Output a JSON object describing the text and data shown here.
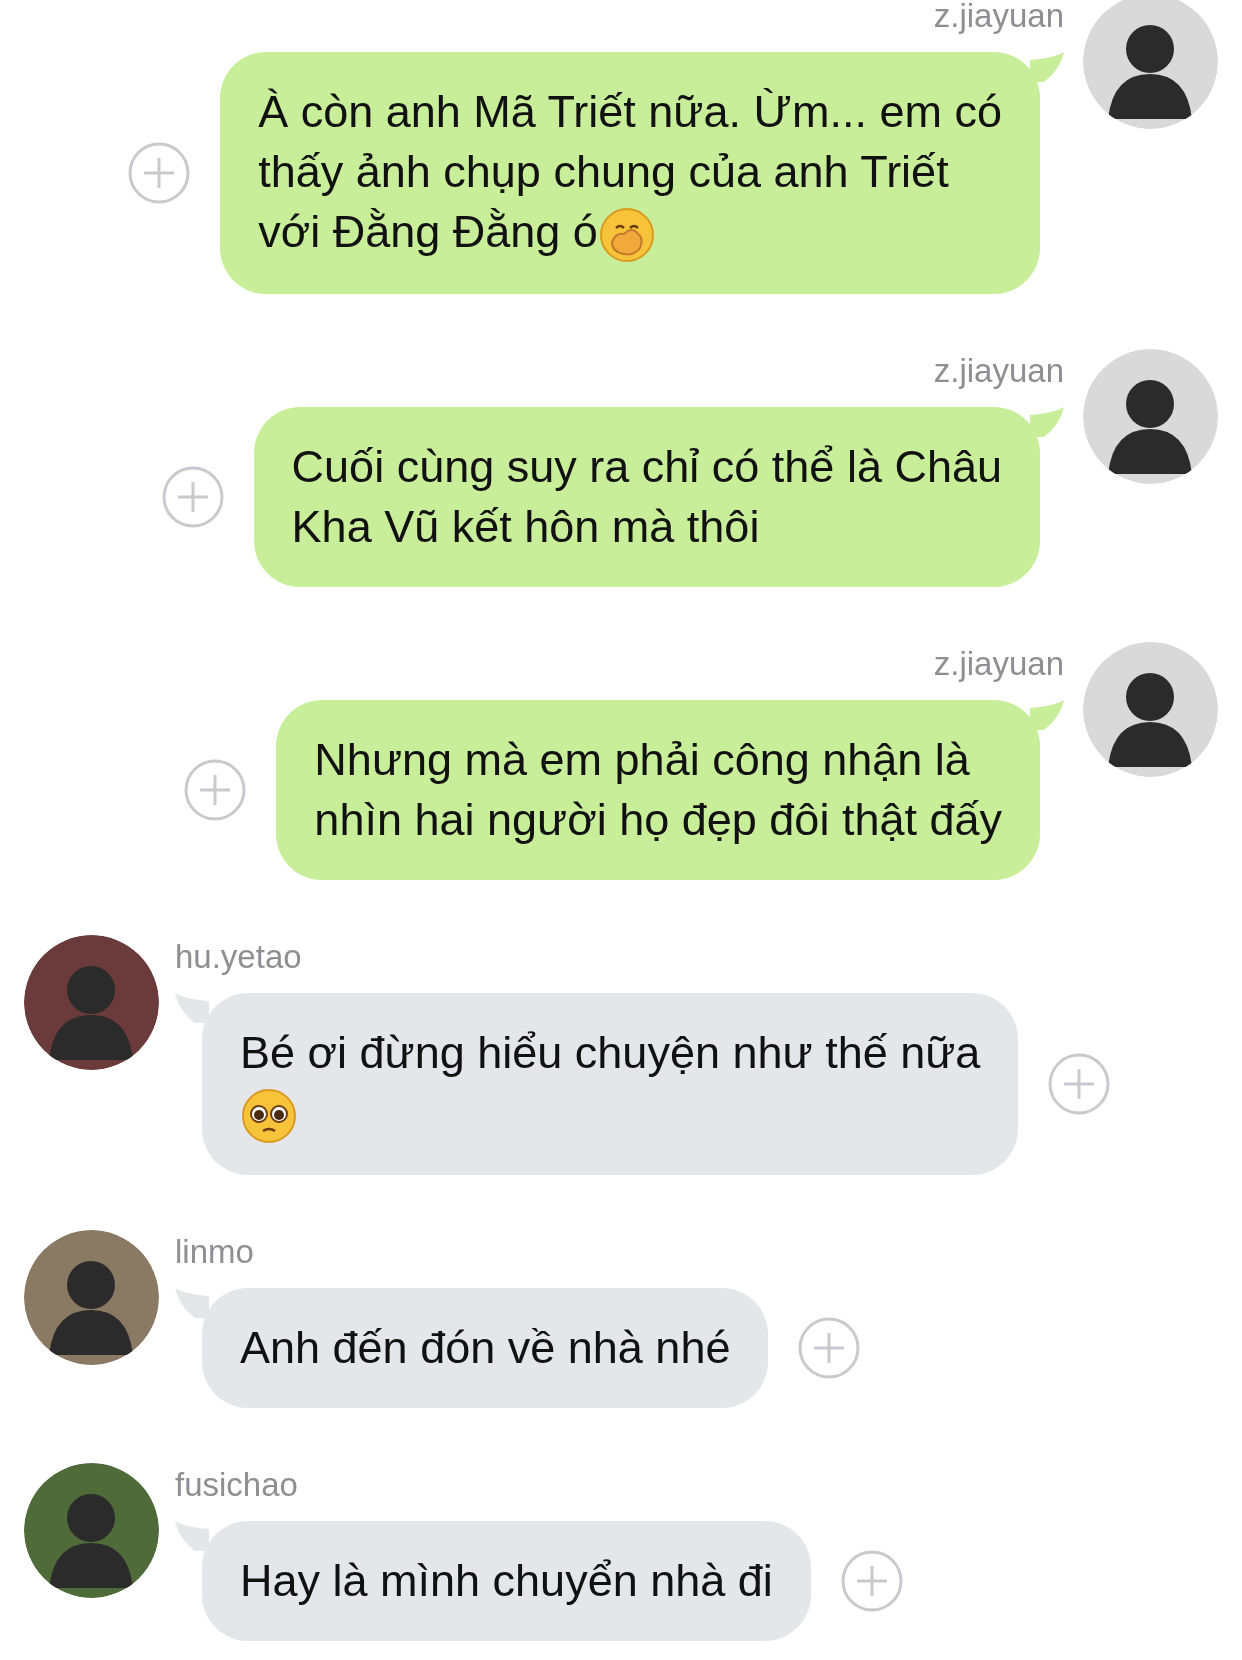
{
  "messages": [
    {
      "kind": "outgoing",
      "sender": "z.jiayuan",
      "text": "À còn anh Mã Triết nữa. Ừm... em có\nthấy ảnh chụp chung của anh Triết\nvới Đằng Đằng ó",
      "emoji": {
        "kind": "hand-over-mouth",
        "own_line": false
      }
    },
    {
      "kind": "outgoing",
      "sender": "z.jiayuan",
      "text": "Cuối cùng suy ra chỉ có thể là Châu\nKha Vũ kết hôn mà thôi"
    },
    {
      "kind": "outgoing",
      "sender": "z.jiayuan",
      "text": "Nhưng mà em phải công nhận là\nnhìn hai người họ đẹp đôi thật đấy"
    },
    {
      "kind": "incoming",
      "sender": "hu.yetao",
      "text": "Bé ơi đừng hiểu chuyện như thế nữa",
      "emoji": {
        "kind": "pleading",
        "own_line": true
      }
    },
    {
      "kind": "incoming",
      "sender": "linmo",
      "text": "Anh đến đón về nhà nhé"
    },
    {
      "kind": "incoming",
      "sender": "fusichao",
      "text": "Hay là mình chuyển nhà đi"
    }
  ]
}
